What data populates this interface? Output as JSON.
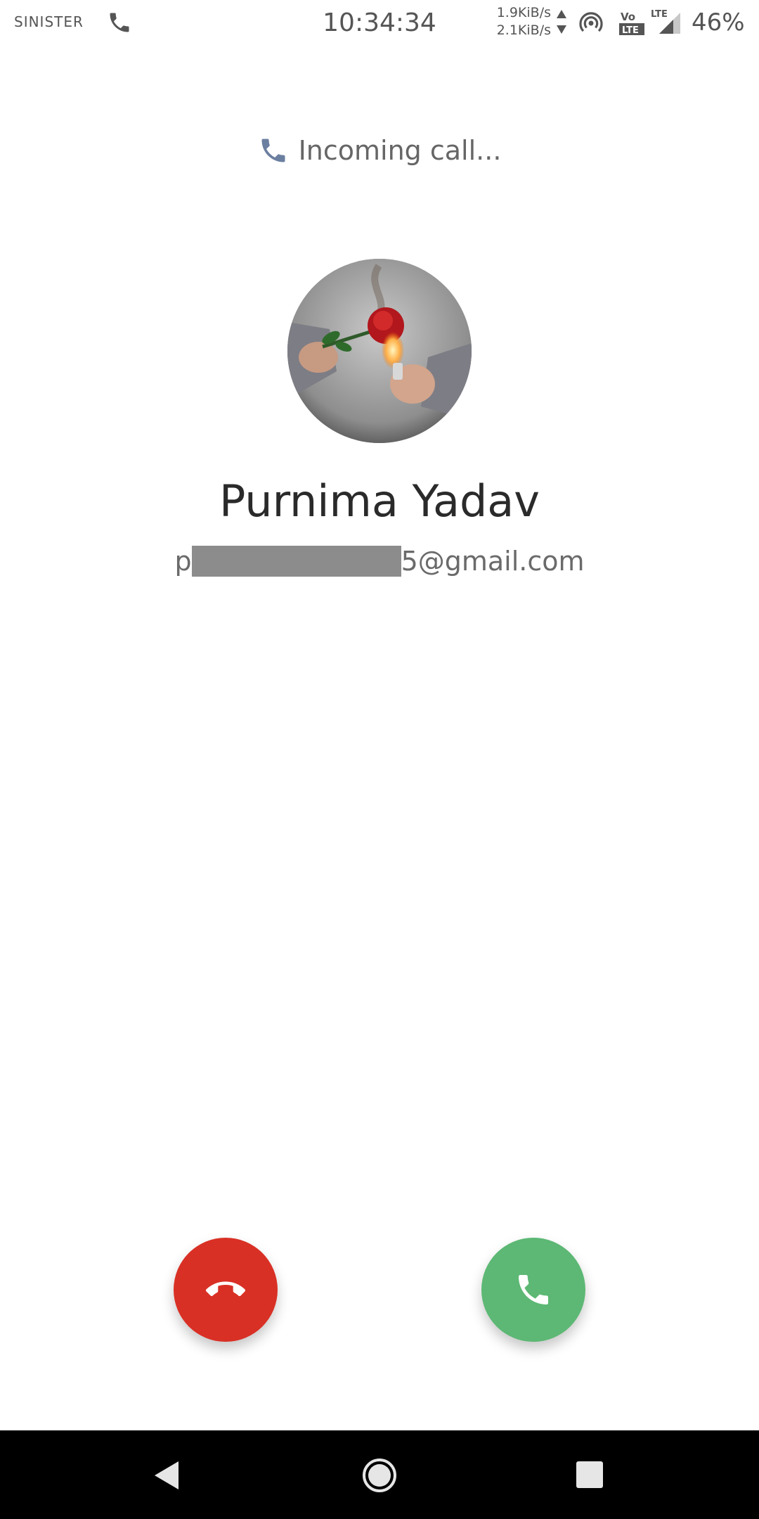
{
  "status_bar": {
    "carrier": "SINISTER",
    "clock": "10:34:34",
    "net_up": "1.9KiB/s",
    "net_down": "2.1KiB/s",
    "volte_label": "Vo LTE",
    "lte_label": "LTE",
    "battery": "46%",
    "icons": [
      "phone-icon",
      "data-arrows-icon",
      "hotspot-icon",
      "volte-icon",
      "signal-icon"
    ]
  },
  "call": {
    "status_text": "Incoming call...",
    "caller_name": "Purnima Yadav",
    "email_prefix": "p",
    "email_suffix": "5@gmail.com"
  },
  "buttons": {
    "decline_icon": "hang-up-icon",
    "accept_icon": "phone-icon"
  },
  "colors": {
    "decline": "#d93025",
    "accept": "#5cb874",
    "incoming_icon": "#6b7fa0"
  },
  "nav": {
    "items": [
      "back-icon",
      "home-icon",
      "recents-icon"
    ]
  }
}
